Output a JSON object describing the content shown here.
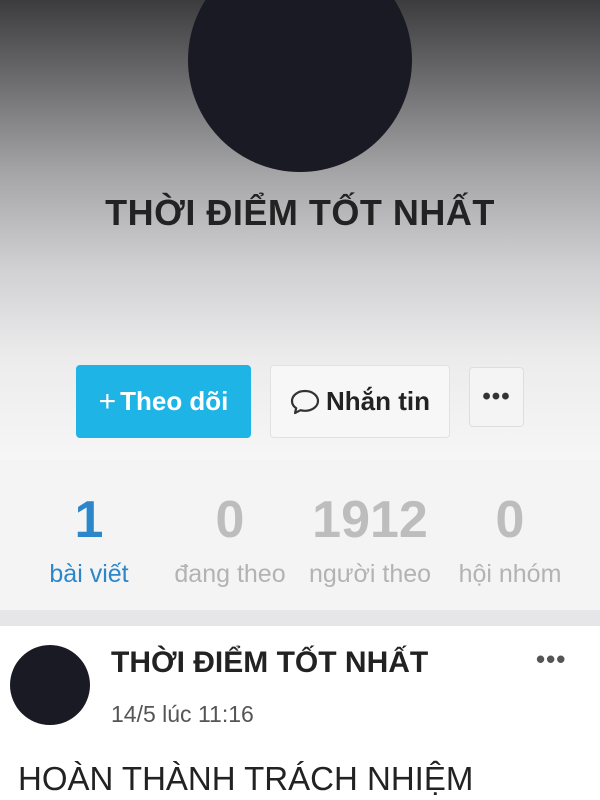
{
  "profile": {
    "name": "THỜI ĐIỂM TỐT NHẤT"
  },
  "actions": {
    "follow_label": "Theo dõi",
    "follow_prefix": "+",
    "message_label": "Nhắn tin",
    "more_label": "•••"
  },
  "stats": [
    {
      "value": "1",
      "label": "bài viết"
    },
    {
      "value": "0",
      "label": "đang theo"
    },
    {
      "value": "1912",
      "label": "người theo"
    },
    {
      "value": "0",
      "label": "hội nhóm"
    }
  ],
  "post": {
    "author": "THỜI ĐIỂM TỐT NHẤT",
    "time": "14/5 lúc 11:16",
    "more_label": "•••",
    "text": "HOÀN THÀNH TRÁCH NHIỆM"
  },
  "colors": {
    "follow_button": "#1fb4e6",
    "active_stat": "#2b87c9",
    "avatar": "#191a24"
  }
}
